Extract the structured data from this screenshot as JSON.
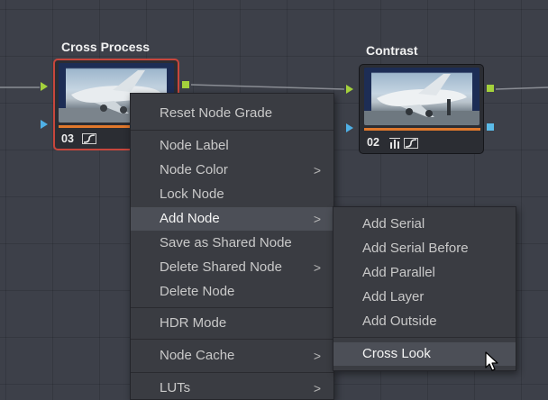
{
  "nodes": {
    "cross_process": {
      "title": "Cross Process",
      "number": "03"
    },
    "contrast": {
      "title": "Contrast",
      "number": "02"
    }
  },
  "icons": {
    "curve": "curve-icon",
    "levels": "levels-icon",
    "chevron": "chevron-right-icon",
    "cursor": "mouse-cursor-icon"
  },
  "context_menu": {
    "items": [
      {
        "label": "Reset Node Grade",
        "submenu": false
      },
      {
        "label": "Node Label",
        "submenu": false
      },
      {
        "label": "Node Color",
        "submenu": true
      },
      {
        "label": "Lock Node",
        "submenu": false
      },
      {
        "label": "Add Node",
        "submenu": true,
        "highlighted": true
      },
      {
        "label": "Save as Shared Node",
        "submenu": false
      },
      {
        "label": "Delete Shared Node",
        "submenu": true
      },
      {
        "label": "Delete Node",
        "submenu": false
      },
      {
        "label": "HDR Mode",
        "submenu": false
      },
      {
        "label": "Node Cache",
        "submenu": true
      },
      {
        "label": "LUTs",
        "submenu": true
      }
    ]
  },
  "submenu": {
    "items": [
      {
        "label": "Add Serial"
      },
      {
        "label": "Add Serial Before"
      },
      {
        "label": "Add Parallel"
      },
      {
        "label": "Add Layer"
      },
      {
        "label": "Add Outside"
      },
      {
        "label": "Cross Look",
        "highlighted": true
      }
    ]
  },
  "colors": {
    "background": "#3d4049",
    "selected_border": "#c8463c",
    "input_port_green": "#a4d13c",
    "input_port_blue": "#4fb0e6",
    "progress_orange": "#e0782c",
    "menu_bg": "#3a3c42",
    "menu_highlight": "#4c4f57"
  }
}
